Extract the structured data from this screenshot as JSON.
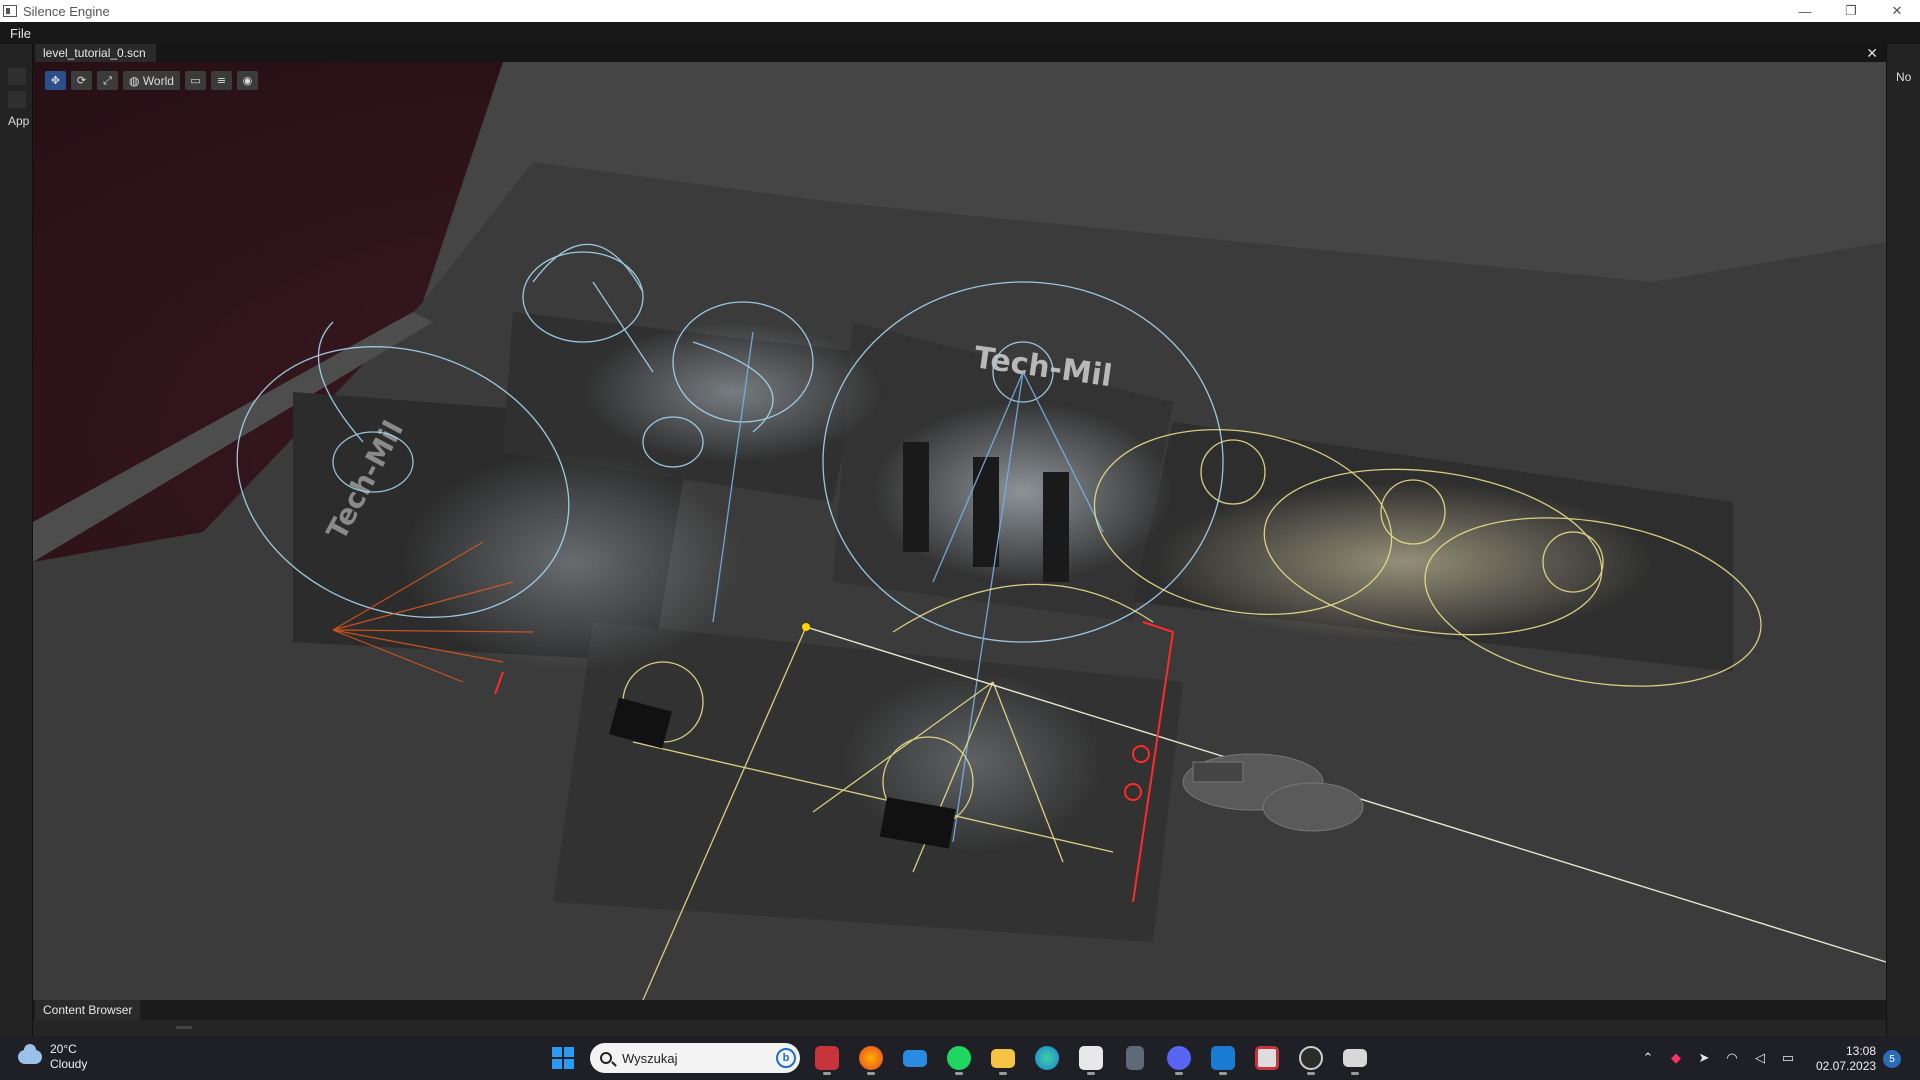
{
  "window": {
    "title": "Silence Engine",
    "controls": {
      "minimize": "—",
      "restore": "❐",
      "close": "✕"
    }
  },
  "menu": {
    "items": [
      "File"
    ]
  },
  "left_panel": {
    "label": "App"
  },
  "right_panel": {
    "label": "No"
  },
  "editor": {
    "tab_label": "level_tutorial_0.scn",
    "close_glyph": "✕"
  },
  "toolbar": {
    "space_label": "World",
    "tools": [
      "translate-icon",
      "rotate-icon",
      "scale-icon",
      "world-icon",
      "snap-icon",
      "grid-icon",
      "camera-icon"
    ]
  },
  "scene": {
    "sign_texts": [
      "Tech-Mil",
      "Tech-Mil"
    ],
    "colors": {
      "space": "#2b1218",
      "floor": "#3a3a3a",
      "light_gizmo_cool": "#a8d8f0",
      "light_gizmo_warm": "#e8e08a",
      "probe_red": "#ff2a2a",
      "spot_orange": "#e05a1e"
    }
  },
  "content_browser": {
    "tab_label": "Content Browser"
  },
  "taskbar": {
    "weather": {
      "temperature": "20°C",
      "condition": "Cloudy"
    },
    "search_placeholder": "Wyszukaj",
    "bing_glyph": "b",
    "apps": [
      "store-icon",
      "firefox-icon",
      "mail-icon",
      "spotify-icon",
      "file-explorer-icon",
      "edge-icon",
      "app-icon",
      "calculator-icon",
      "discord-icon",
      "vscode-icon",
      "silence-engine-icon",
      "obs-icon",
      "terminal-icon"
    ],
    "clock": {
      "time": "13:08",
      "date": "02.07.2023"
    },
    "notification_count": "5"
  }
}
